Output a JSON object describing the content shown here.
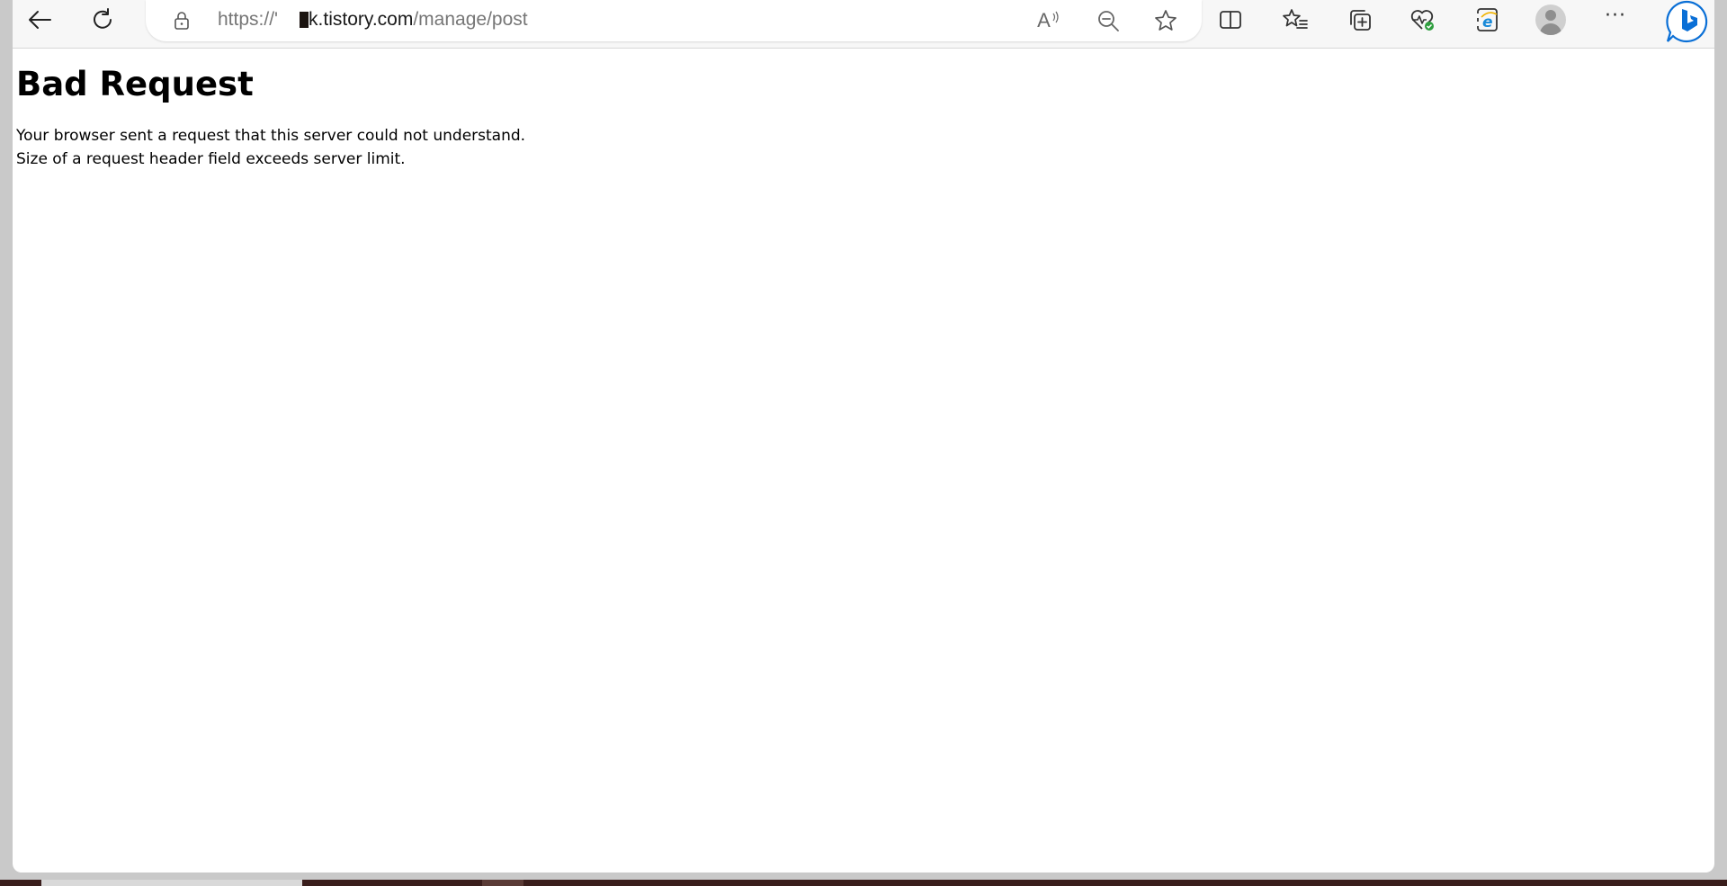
{
  "browser": {
    "url_prefix": "https://'",
    "url_host": "k.tistory.com",
    "url_path": "/manage/post",
    "toolbar_icons": [
      "back-arrow-icon",
      "refresh-icon",
      "lock-icon",
      "read-aloud-icon",
      "zoom-out-icon",
      "favorite-star-icon",
      "split-screen-icon",
      "favorites-list-icon",
      "collections-icon",
      "browser-essentials-icon",
      "internet-explorer-mode-icon",
      "profile-avatar-icon",
      "more-options-icon",
      "bing-copilot-icon"
    ],
    "read_aloud_glyph": "A",
    "more_glyph": "···"
  },
  "page": {
    "heading": "Bad Request",
    "line1": "Your browser sent a request that this server could not understand.",
    "line2": "Size of a request header field exceeds server limit."
  },
  "colors": {
    "accent_blue": "#1a73e8",
    "bing_blue": "#0a6fd6",
    "essentials_green": "#2e9e3e"
  }
}
